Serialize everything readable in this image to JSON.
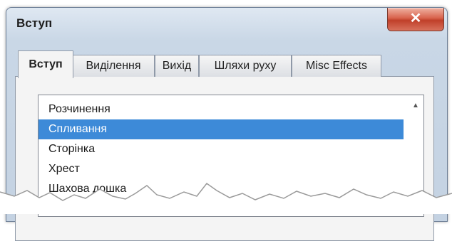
{
  "window": {
    "title": "Вступ",
    "close_glyph": "✕"
  },
  "tabs": [
    {
      "label": "Вступ",
      "active": true
    },
    {
      "label": "Виділення",
      "active": false
    },
    {
      "label": "Вихід",
      "active": false
    },
    {
      "label": "Шляхи руху",
      "active": false
    },
    {
      "label": "Misc Effects",
      "active": false
    }
  ],
  "list": {
    "items": [
      {
        "label": "Розчинення",
        "selected": false
      },
      {
        "label": "Спливання",
        "selected": true
      },
      {
        "label": "Сторінка",
        "selected": false
      },
      {
        "label": "Хрест",
        "selected": false
      },
      {
        "label": "Шахова дошка",
        "selected": false
      }
    ],
    "scroll_up_glyph": "▲"
  },
  "colors": {
    "selection": "#3d8ad8",
    "close_button": "#c9452c"
  }
}
